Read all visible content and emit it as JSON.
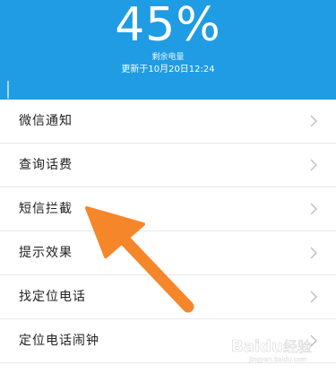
{
  "header": {
    "battery_percent": "45%",
    "battery_label": "剩余电量",
    "updated_text": "更新于10月20日12:24",
    "color": "#1f9ce3"
  },
  "menu": {
    "items": [
      {
        "label": "微信通知"
      },
      {
        "label": "查询话费"
      },
      {
        "label": "短信拦截"
      },
      {
        "label": "提示效果"
      },
      {
        "label": "找定位电话"
      },
      {
        "label": "定位电话闹钟"
      }
    ],
    "chevron_icon": "chevron-right-icon"
  },
  "annotation": {
    "arrow_color": "#f5862a",
    "points_to": "短信拦截"
  },
  "watermark": {
    "text": "Baidu 经验",
    "url_text": "jingyan.baidu.com"
  }
}
